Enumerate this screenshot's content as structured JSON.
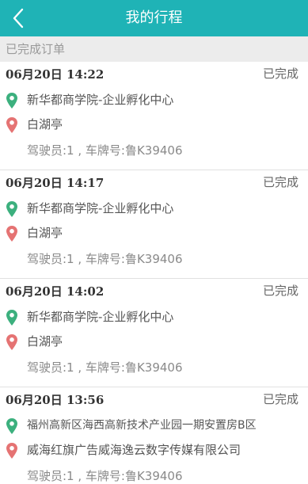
{
  "header": {
    "title": "我的行程",
    "back_icon": "chevron-left-icon",
    "background": "#1fb3b6"
  },
  "section": {
    "label": "已完成订单"
  },
  "colors": {
    "from_pin": "#3cb07e",
    "to_pin": "#e57373"
  },
  "orders": [
    {
      "time": "06月20日 14:22",
      "status": "已完成",
      "from": "新华都商学院-企业孵化中心",
      "to": "白湖亭",
      "driver": "驾驶员:1 , 车牌号:鲁K39406"
    },
    {
      "time": "06月20日 14:17",
      "status": "已完成",
      "from": "新华都商学院-企业孵化中心",
      "to": "白湖亭",
      "driver": "驾驶员:1 , 车牌号:鲁K39406"
    },
    {
      "time": "06月20日 14:02",
      "status": "已完成",
      "from": "新华都商学院-企业孵化中心",
      "to": "白湖亭",
      "driver": "驾驶员:1 , 车牌号:鲁K39406"
    },
    {
      "time": "06月20日 13:56",
      "status": "已完成",
      "from": "福州高新区海西高新技术产业园一期安置房B区",
      "to": "威海红旗广告威海逸云数字传媒有限公司",
      "driver": "驾驶员:1 , 车牌号:鲁K39406"
    }
  ]
}
